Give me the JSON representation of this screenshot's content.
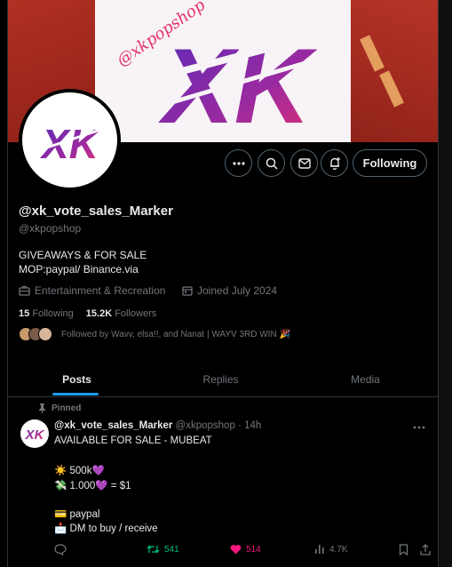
{
  "profile": {
    "display_name": "@xk_vote_sales_Marker",
    "handle": "@xkpopshop",
    "bio_line1": "GIVEAWAYS & FOR SALE",
    "bio_line2": "MOP:paypal/ Binance.via",
    "category": "Entertainment & Recreation",
    "joined": "Joined July 2024",
    "following_count": "15",
    "following_label": "Following",
    "followers_count": "15.2K",
    "followers_label": "Followers",
    "followed_by": "Followed by Wavv, elsa!!, and Nanat | WAYV 3RD WIN 🎉",
    "banner_text": "@xkpopshop",
    "logo_text": "XK"
  },
  "buttons": {
    "more": "More",
    "search": "Search",
    "message": "Message",
    "subscribe": "Notify",
    "following": "Following"
  },
  "tabs": [
    "Posts",
    "Replies",
    "Media"
  ],
  "tweet": {
    "pinned_label": "Pinned",
    "author": "@xk_vote_sales_Marker",
    "handle_time": "@xkpopshop · 14h",
    "lines": [
      "AVAILABLE FOR SALE - MUBEAT",
      "",
      "☀️ 500k💜",
      "💸 1.000💜 = $1",
      "",
      "💳 paypal",
      "📩 DM to buy / receive"
    ],
    "retweets": "541",
    "likes": "514",
    "views": "4.7K"
  },
  "colors": {
    "accent": "#1d9bf0",
    "banner_red": "#a62a1e",
    "logo_purple": "#6a2bb3",
    "logo_pink": "#e5306f",
    "retweet_green": "#00ba7c",
    "like_pink": "#f91880"
  }
}
